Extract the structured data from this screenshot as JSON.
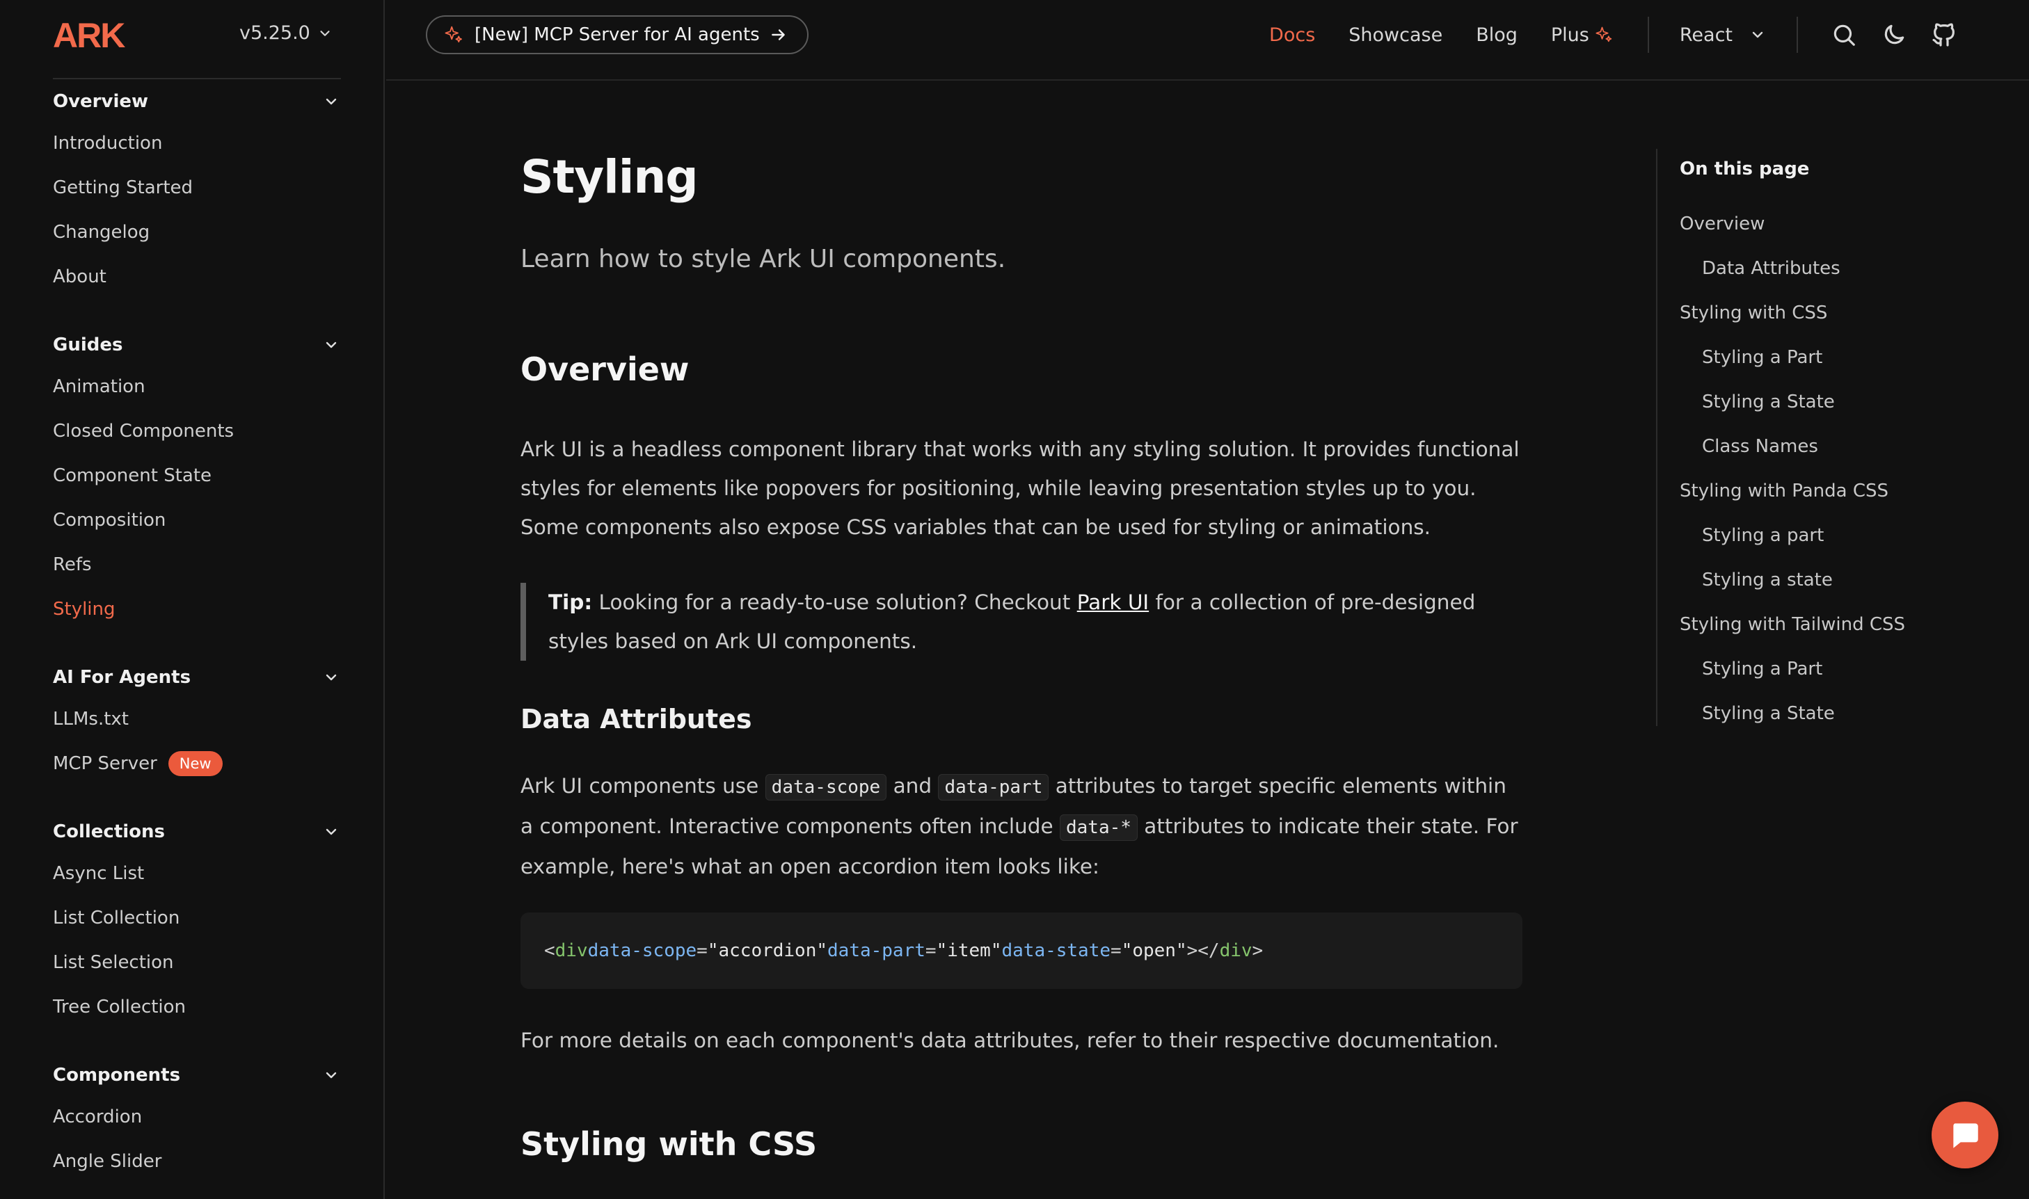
{
  "brand": {
    "logo_text": "ARK",
    "accent": "#f26a4b"
  },
  "version": "v5.25.0",
  "header": {
    "promo_label": "[New] MCP Server for AI agents",
    "nav": {
      "docs": "Docs",
      "showcase": "Showcase",
      "blog": "Blog",
      "plus": "Plus"
    },
    "framework": "React",
    "icons": [
      "search-icon",
      "moon-icon",
      "github-icon"
    ]
  },
  "sidebar": {
    "overview": {
      "title": "Overview",
      "items": [
        "Introduction",
        "Getting Started",
        "Changelog",
        "About"
      ]
    },
    "guides": {
      "title": "Guides",
      "items": [
        "Animation",
        "Closed Components",
        "Component State",
        "Composition",
        "Refs",
        "Styling"
      ],
      "active": "Styling"
    },
    "ai": {
      "title": "AI For Agents",
      "items": [
        "LLMs.txt",
        "MCP Server"
      ],
      "badge": "New"
    },
    "collections": {
      "title": "Collections",
      "items": [
        "Async List",
        "List Collection",
        "List Selection",
        "Tree Collection"
      ]
    },
    "components": {
      "title": "Components",
      "items": [
        "Accordion",
        "Angle Slider"
      ]
    }
  },
  "main": {
    "title": "Styling",
    "subtitle": "Learn how to style Ark UI components.",
    "overview_heading": "Overview",
    "overview_p1": "Ark UI is a headless component library that works with any styling solution. It provides functional styles for elements like popovers for positioning, while leaving presentation styles up to you. Some components also expose CSS variables that can be used for styling or animations.",
    "tip_label": "Tip:",
    "tip_text_before": " Looking for a ready-to-use solution? Checkout ",
    "tip_link": "Park UI",
    "tip_text_after": " for a collection of pre-designed styles based on Ark UI components.",
    "data_attr_heading": "Data Attributes",
    "data_attr_p_a": "Ark UI components use ",
    "code_scope": "data-scope",
    "data_attr_p_b": " and ",
    "code_part": "data-part",
    "data_attr_p_c": " attributes to target specific elements within a component. Interactive components often include ",
    "code_star": "data-*",
    "data_attr_p_d": " attributes to indicate their state. For example, here's what an open accordion item looks like:",
    "code": {
      "lt_open": "<",
      "tag": "div",
      "attr_scope": "data-scope",
      "val_scope": "\"accordion\"",
      "attr_part": "data-part",
      "val_part": "\"item\"",
      "attr_state": "data-state",
      "val_state": "\"open\"",
      "close_open": "></",
      "close_end": ">",
      "eq": "="
    },
    "details_p": "For more details on each component's data attributes, refer to their respective documentation.",
    "css_heading": "Styling with CSS"
  },
  "toc": {
    "title": "On this page",
    "items": [
      {
        "label": "Overview",
        "sub": false
      },
      {
        "label": "Data Attributes",
        "sub": true
      },
      {
        "label": "Styling with CSS",
        "sub": false
      },
      {
        "label": "Styling a Part",
        "sub": true
      },
      {
        "label": "Styling a State",
        "sub": true
      },
      {
        "label": "Class Names",
        "sub": true
      },
      {
        "label": "Styling with Panda CSS",
        "sub": false
      },
      {
        "label": "Styling a part",
        "sub": true
      },
      {
        "label": "Styling a state",
        "sub": true
      },
      {
        "label": "Styling with Tailwind CSS",
        "sub": false
      },
      {
        "label": "Styling a Part",
        "sub": true
      },
      {
        "label": "Styling a State",
        "sub": true
      }
    ]
  }
}
